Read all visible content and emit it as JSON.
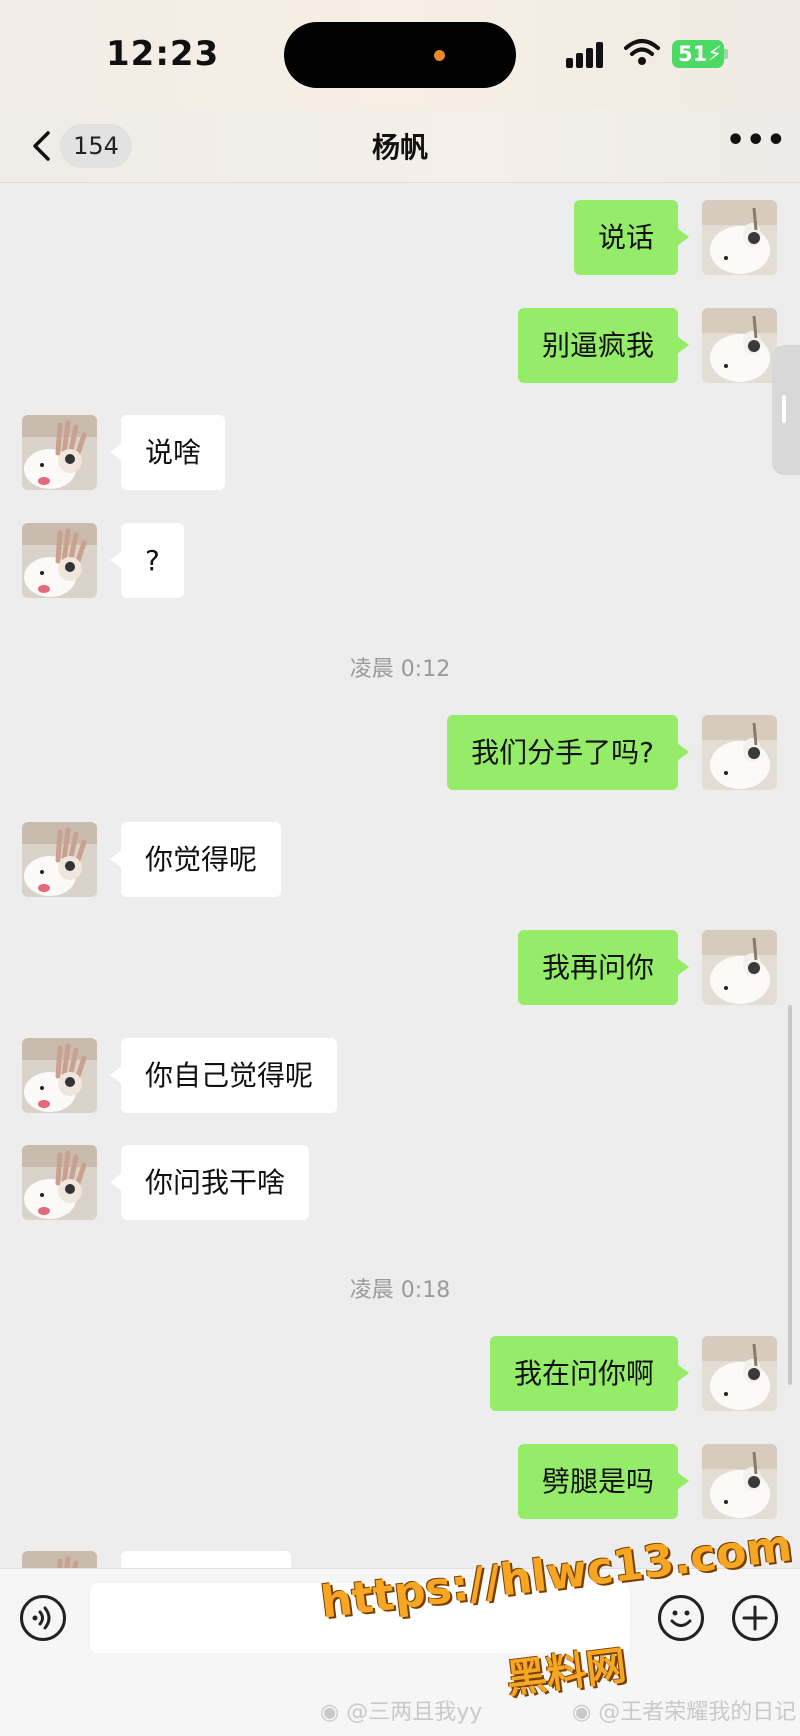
{
  "status_bar": {
    "time": "12:23",
    "battery": "51"
  },
  "nav": {
    "unread_count": "154",
    "title": "杨帆"
  },
  "messages": [
    {
      "side": "right",
      "text": "说话"
    },
    {
      "side": "right",
      "text": "别逼疯我"
    },
    {
      "side": "left",
      "text": "说啥"
    },
    {
      "side": "left",
      "text": "?"
    },
    {
      "type": "time",
      "text": "凌晨 0:12"
    },
    {
      "side": "right",
      "text": "我们分手了吗?"
    },
    {
      "side": "left",
      "text": "你觉得呢"
    },
    {
      "side": "right",
      "text": "我再问你"
    },
    {
      "side": "left",
      "text": "你自己觉得呢"
    },
    {
      "side": "left",
      "text": "你问我干啥"
    },
    {
      "type": "time",
      "text": "凌晨 0:18"
    },
    {
      "side": "right",
      "text": "我在问你啊"
    },
    {
      "side": "right",
      "text": "劈腿是吗"
    }
  ],
  "input": {
    "value": "",
    "placeholder": ""
  },
  "watermark": {
    "url": "https://hlwc13.com",
    "site_name": "黑料网",
    "weibo_1": "@三两且我yy",
    "weibo_2": "@王者荣耀我的日记"
  },
  "colors": {
    "sent_bubble": "#95ec69",
    "received_bubble": "#ffffff",
    "background": "#ededed"
  },
  "icons": [
    "back-chevron-icon",
    "more-dots-icon",
    "voice-icon",
    "emoji-icon",
    "plus-icon",
    "signal-icon",
    "wifi-icon",
    "battery-icon"
  ]
}
